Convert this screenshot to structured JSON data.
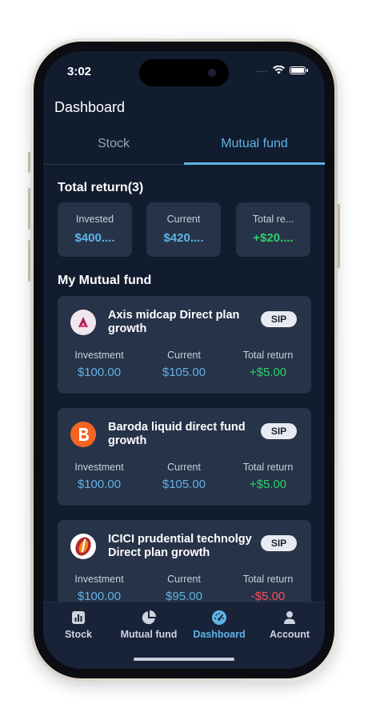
{
  "status_bar": {
    "time": "3:02",
    "signal": "....",
    "icons": [
      "wifi-icon",
      "battery-icon"
    ]
  },
  "header": {
    "title": "Dashboard"
  },
  "tabs": [
    {
      "label": "Stock",
      "active": false
    },
    {
      "label": "Mutual fund",
      "active": true
    }
  ],
  "total_return": {
    "heading": "Total return(3)",
    "cards": [
      {
        "label": "Invested",
        "value": "$400....",
        "color": "#5fb4e6"
      },
      {
        "label": "Current",
        "value": "$420....",
        "color": "#5fb4e6"
      },
      {
        "label": "Total re...",
        "value": "+$20....",
        "color": "#2fd16a"
      }
    ]
  },
  "my_funds": {
    "heading": "My Mutual fund",
    "items": [
      {
        "name": "Axis midcap Direct plan growth",
        "badge": "SIP",
        "logo": "axis-logo-icon",
        "investment_label": "Investment",
        "investment": "$100.00",
        "current_label": "Current",
        "current": "$105.00",
        "return_label": "Total return",
        "return": "+$5.00",
        "return_color": "#2fd16a"
      },
      {
        "name": "Baroda liquid direct fund growth",
        "badge": "SIP",
        "logo": "baroda-logo-icon",
        "investment_label": "Investment",
        "investment": "$100.00",
        "current_label": "Current",
        "current": "$105.00",
        "return_label": "Total return",
        "return": "+$5.00",
        "return_color": "#2fd16a"
      },
      {
        "name": "ICICI prudential technolgy Direct plan growth",
        "badge": "SIP",
        "logo": "icici-logo-icon",
        "investment_label": "Investment",
        "investment": "$100.00",
        "current_label": "Current",
        "current": "$95.00",
        "return_label": "Total return",
        "return": "-$5.00",
        "return_color": "#ff4b56"
      }
    ]
  },
  "bottom_nav": [
    {
      "label": "Stock",
      "icon": "chart-bar-icon",
      "active": false
    },
    {
      "label": "Mutual fund",
      "icon": "pie-chart-icon",
      "active": false
    },
    {
      "label": "Dashboard",
      "icon": "gauge-icon",
      "active": true
    },
    {
      "label": "Account",
      "icon": "person-icon",
      "active": false
    }
  ],
  "colors": {
    "accent": "#5fb4e6",
    "positive": "#2fd16a",
    "negative": "#ff4b56",
    "background": "#121c2f",
    "card": "#273348"
  }
}
